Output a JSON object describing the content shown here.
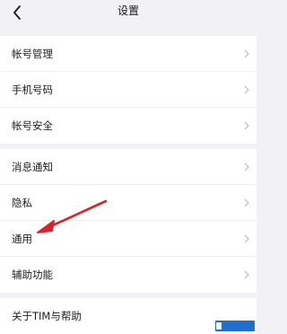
{
  "nav": {
    "title": "设置",
    "back_icon": "chevron-left-icon"
  },
  "groups": [
    {
      "items": [
        {
          "label": "帐号管理"
        },
        {
          "label": "手机号码"
        },
        {
          "label": "帐号安全"
        }
      ]
    },
    {
      "items": [
        {
          "label": "消息通知"
        },
        {
          "label": "隐私"
        },
        {
          "label": "通用"
        },
        {
          "label": "辅助功能"
        }
      ]
    },
    {
      "items": [
        {
          "label": "关于TIM与帮助"
        }
      ]
    }
  ],
  "annotation": {
    "arrow_color": "#d9232a",
    "target": "通用"
  },
  "watermark": {
    "color": "#1f6fd1"
  }
}
